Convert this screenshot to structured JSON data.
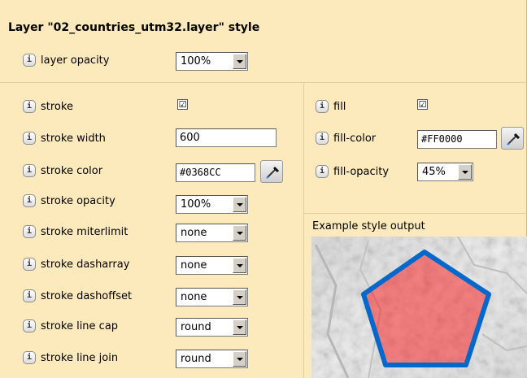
{
  "title": "Layer \"02_countries_utm32.layer\" style",
  "info_icon_glyph": "i",
  "picker_icon": "eyedropper-icon",
  "accent_color": "#FCE9BC",
  "layer_opacity": {
    "label": "layer opacity",
    "value": "100%"
  },
  "stroke": {
    "label": "stroke",
    "checked": "☑",
    "width": {
      "label": "stroke width",
      "value": "600"
    },
    "color": {
      "label": "stroke color",
      "value": "#0368CC"
    },
    "opacity": {
      "label": "stroke opacity",
      "value": "100%"
    },
    "miterlimit": {
      "label": "stroke miterlimit",
      "value": "none"
    },
    "dasharray": {
      "label": "stroke dasharray",
      "value": "none"
    },
    "dashoffset": {
      "label": "stroke dashoffset",
      "value": "none"
    },
    "linecap": {
      "label": "stroke line cap",
      "value": "round"
    },
    "linejoin": {
      "label": "stroke line join",
      "value": "round"
    }
  },
  "fill": {
    "label": "fill",
    "checked": "☑",
    "color": {
      "label": "fill-color",
      "value": "#FF0000"
    },
    "opacity": {
      "label": "fill-opacity",
      "value": "45%"
    }
  },
  "example": {
    "label": "Example style output",
    "stroke_color": "#0368CC",
    "fill_color": "#FF0000",
    "fill_opacity": 0.45
  }
}
